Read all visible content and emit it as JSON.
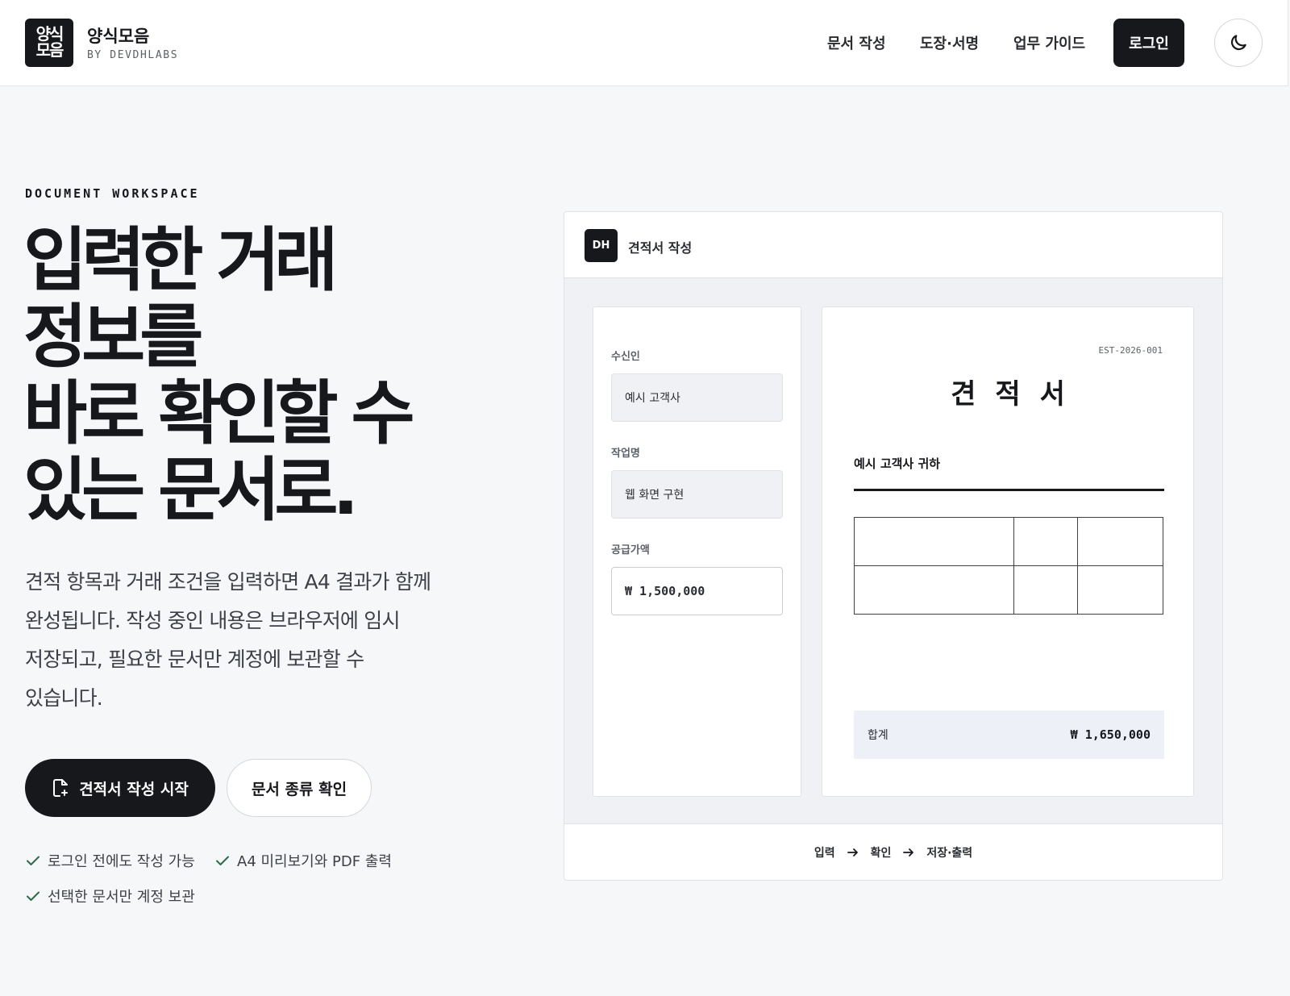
{
  "header": {
    "logo_line1": "양식",
    "logo_line2": "모음",
    "brand_name": "양식모음",
    "brand_sub": "BY DEVDHLABS",
    "nav": [
      "문서 작성",
      "도장·서명",
      "업무 가이드"
    ],
    "login_label": "로그인",
    "theme_icon": "moon-icon"
  },
  "hero": {
    "eyebrow": "DOCUMENT WORKSPACE",
    "title_lines": [
      "입력한 거래",
      "정보를",
      "바로 확인할 수",
      "있는 문서로."
    ],
    "description_lines": [
      "견적 항목과 거래 조건을 입력하면 A4 결과가 함께",
      "완성됩니다. 작성 중인 내용은 브라우저에 임시",
      "저장되고, 필요한 문서만 계정에 보관할 수",
      "있습니다."
    ],
    "primary_button": "견적서 작성 시작",
    "secondary_button": "문서 종류 확인",
    "features": [
      "로그인 전에도 작성 가능",
      "A4 미리보기와 PDF 출력",
      "선택한 문서만 계정 보관"
    ],
    "check_color": "#2f6b4a"
  },
  "preview": {
    "badge": "DH",
    "title": "견적서 작성",
    "form": {
      "fields": [
        {
          "label": "수신인",
          "value": "예시 고객사"
        },
        {
          "label": "작업명",
          "value": "웹 화면 구현"
        },
        {
          "label": "공급가액",
          "value": "₩ 1,500,000"
        }
      ]
    },
    "document": {
      "number": "EST-2026-001",
      "title": "견적서",
      "recipient": "예시 고객사 귀하",
      "total_label": "합계",
      "total_value": "₩ 1,650,000"
    },
    "steps": [
      "입력",
      "확인",
      "저장·출력"
    ]
  }
}
